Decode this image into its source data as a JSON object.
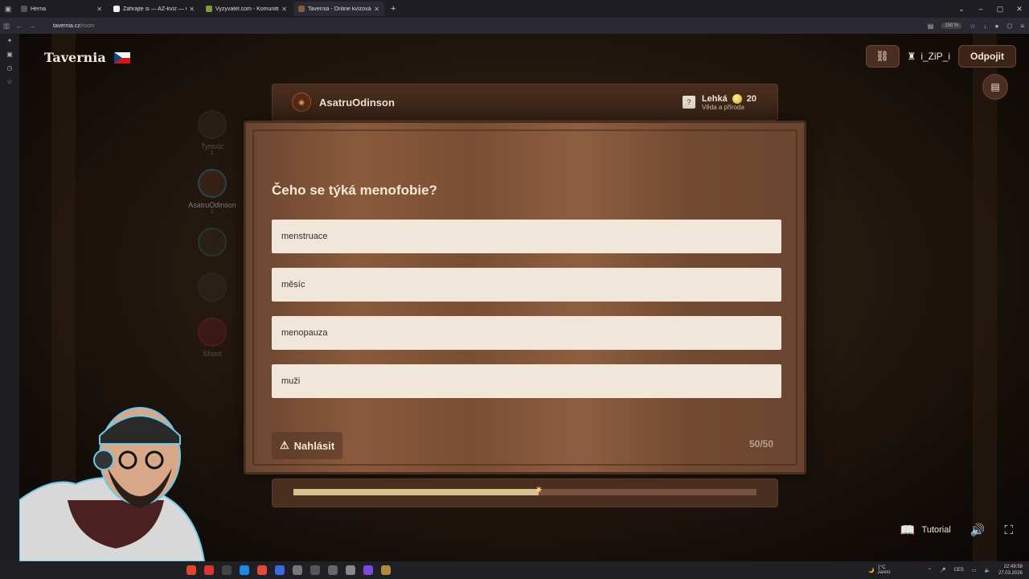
{
  "browser": {
    "tabs": [
      {
        "label": "Herna",
        "color": "#555"
      },
      {
        "label": "Zahrajte si — AZ-kvíz — Český",
        "color": "#f0f0f0"
      },
      {
        "label": "Vyzyvatel.com - Komunitní věd",
        "color": "#7b9a3a"
      },
      {
        "label": "Tavernia - Online kvízová h",
        "color": "#8a5a3c"
      }
    ],
    "url_host": "tavernia.cz",
    "url_path": "/room",
    "zoom": "150 %"
  },
  "app": {
    "brand": "Tavernia",
    "user_name": "i_ZiP_i",
    "disconnect_label": "Odpojit"
  },
  "players": [
    {
      "name": "Tyrexic",
      "score": "1"
    },
    {
      "name": "AsatruOdinson",
      "score": "1"
    },
    {
      "name": "",
      "score": ""
    },
    {
      "name": "",
      "score": ""
    },
    {
      "name": "Shoot",
      "score": ""
    }
  ],
  "round": {
    "player": "AsatruOdinson",
    "difficulty": "Lehká",
    "points": "20",
    "category": "Věda a příroda",
    "question": "Čeho se týká menofobie?",
    "answers": [
      "menstruace",
      "měsíc",
      "menopauza",
      "muži"
    ],
    "report_label": "Nahlásit",
    "counter": "50/50",
    "progress": 0.53
  },
  "tools": {
    "tutorial_label": "Tutorial"
  },
  "taskbar": {
    "temperature": "1°C",
    "weather": "Jasno",
    "lang": "CES",
    "time": "22:49:58",
    "date": "27.03.2026"
  },
  "colors": {
    "accent": "#f3e8d4",
    "answer_bg": "#f1e6da",
    "progress_fill": "#d8c090"
  }
}
